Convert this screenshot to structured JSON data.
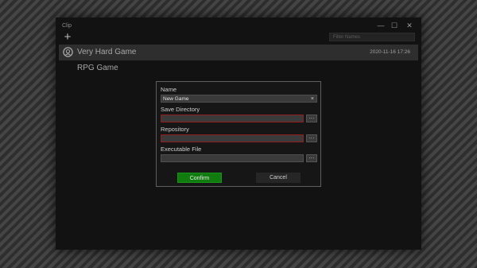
{
  "window": {
    "title": "Clip",
    "minimize_glyph": "—",
    "maximize_glyph": "☐",
    "close_glyph": "✕"
  },
  "toolbar": {
    "add_glyph": "+",
    "filter_placeholder": "Filter Names"
  },
  "games": [
    {
      "name": "Very Hard Game",
      "date": "2020-11-16 17:26",
      "selected": true,
      "icon": "disc-icon"
    },
    {
      "name": "RPG Game",
      "date": "",
      "selected": false
    }
  ],
  "dialog": {
    "name_label": "Name",
    "name_value": "New Game",
    "clear_glyph": "×",
    "save_dir_label": "Save Directory",
    "save_dir_value": "",
    "repository_label": "Repository",
    "repository_value": "",
    "executable_label": "Executable File",
    "executable_value": "",
    "browse_label": "...",
    "confirm_label": "Confirm",
    "cancel_label": "Cancel",
    "error_color": "#8e1f1f",
    "confirm_color": "#107c10"
  }
}
